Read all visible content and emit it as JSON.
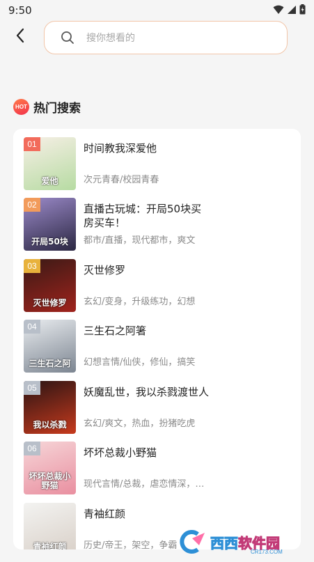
{
  "status_bar": {
    "time": "9:50"
  },
  "search": {
    "placeholder": "搜你想看的"
  },
  "section": {
    "badge": "HOT",
    "title": "热门搜索"
  },
  "books": [
    {
      "rank": "01",
      "title": "时间教我深爱他",
      "tags": "次元青春/校园青春",
      "rank_color": "#f26b5b",
      "cover_from": "#f7efe6",
      "cover_to": "#b6dba2",
      "cover_text": "爱他"
    },
    {
      "rank": "02",
      "title": "直播古玩城：开局50块买房买车！",
      "tags": "都市/直播，现代都市，爽文",
      "rank_color": "#f29b5b",
      "cover_from": "#9b8ac9",
      "cover_to": "#2b2742",
      "cover_text": "开局50块"
    },
    {
      "rank": "03",
      "title": "灭世修罗",
      "tags": "玄幻/变身，升级练功，幻想",
      "rank_color": "#e8b23c",
      "cover_from": "#3a1a16",
      "cover_to": "#a0231c",
      "cover_text": "灭世修罗"
    },
    {
      "rank": "04",
      "title": "三生石之阿箸",
      "tags": "幻想言情/仙侠，修仙，搞笑",
      "rank_color": "#b8bfc9",
      "cover_from": "#e9ecef",
      "cover_to": "#7c8591",
      "cover_text": "三生石之阿"
    },
    {
      "rank": "05",
      "title": "妖魔乱世，我以杀戮渡世人",
      "tags": "玄幻/爽文，热血，扮猪吃虎",
      "rank_color": "#b8bfc9",
      "cover_from": "#2a1414",
      "cover_to": "#c73a1d",
      "cover_text": "我以杀戮"
    },
    {
      "rank": "06",
      "title": "坏坏总裁小野猫",
      "tags": "现代言情/总裁，虐恋情深，宠文",
      "rank_color": "#b8bfc9",
      "cover_from": "#f6d6d8",
      "cover_to": "#e98fa0",
      "cover_text": "坏坏总裁小野猫"
    },
    {
      "rank": "",
      "title": "青袖红颜",
      "tags": "历史/帝王，架空，争霸",
      "rank_color": "#b8bfc9",
      "cover_from": "#f3f3f1",
      "cover_to": "#d8cfc7",
      "cover_text": "青袖红颜"
    }
  ],
  "watermark": {
    "main_a": "西西",
    "main_b": "软件园",
    "sub": "CR173.COM"
  },
  "colors": {
    "accent": "#f2c5a8",
    "hot_from": "#ff7a4a",
    "hot_to": "#f2334b"
  }
}
